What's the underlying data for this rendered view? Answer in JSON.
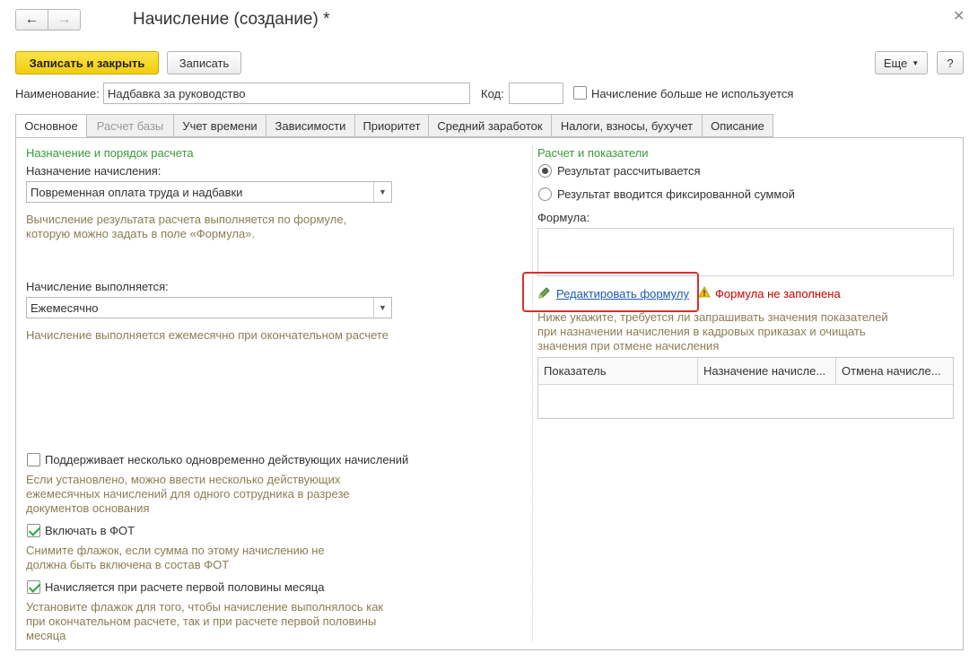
{
  "window": {
    "title": "Начисление (создание) *"
  },
  "nav": {
    "back_icon": "arrow-left-icon",
    "forward_icon": "arrow-right-icon"
  },
  "toolbar": {
    "save_close_label": "Записать и закрыть",
    "save_label": "Записать",
    "more_label": "Еще",
    "help_label": "?"
  },
  "header": {
    "name_label": "Наименование:",
    "name_value": "Надбавка за руководство",
    "code_label": "Код:",
    "code_value": "",
    "unused_label": "Начисление больше не используется"
  },
  "tabs": [
    {
      "label": "Основное"
    },
    {
      "label": "Расчет базы"
    },
    {
      "label": "Учет времени"
    },
    {
      "label": "Зависимости"
    },
    {
      "label": "Приоритет"
    },
    {
      "label": "Средний заработок"
    },
    {
      "label": "Налоги, взносы, бухучет"
    },
    {
      "label": "Описание"
    }
  ],
  "left": {
    "section_title": "Назначение и порядок расчета",
    "purpose_label": "Назначение начисления:",
    "purpose_value": "Повременная оплата труда и надбавки",
    "purpose_hint": "Вычисление результата расчета выполняется по формуле, которую можно задать в поле «Формула».",
    "schedule_label": "Начисление выполняется:",
    "schedule_value": "Ежемесячно",
    "schedule_hint": "Начисление выполняется ежемесячно при окончательном расчете",
    "multi_label": "Поддерживает несколько одновременно действующих начислений",
    "multi_hint": "Если установлено, можно ввести несколько действующих ежемесячных начислений для одного сотрудника в разрезе документов основания",
    "fot_label": "Включать в ФОТ",
    "fot_hint": "Снимите флажок, если сумма по этому начислению не должна быть включена в состав ФОТ",
    "half_label": "Начисляется при расчете первой половины месяца",
    "half_hint": "Установите флажок для того, чтобы начисление выполнялось как при окончательном расчете, так и при расчете первой половины месяца"
  },
  "right": {
    "section_title": "Расчет и показатели",
    "radio_calc": "Результат рассчитывается",
    "radio_fixed": "Результат вводится фиксированной суммой",
    "formula_label": "Формула:",
    "formula_value": "",
    "edit_formula_link": "Редактировать формулу",
    "warning_text": "Формула не заполнена",
    "indicators_hint": "Ниже укажите, требуется ли запрашивать значения показателей при назначении начисления в кадровых приказах и очищать значения при отмене начисления",
    "table_headers": [
      "Показатель",
      "Назначение начисле...",
      "Отмена начисле..."
    ]
  },
  "colors": {
    "primary_button": "#f5d216",
    "section_title": "#3a9b3a",
    "hint_text": "#8b7d55",
    "link": "#1a5bb3",
    "warning": "#cc0000",
    "highlight_box": "#d9302b"
  }
}
